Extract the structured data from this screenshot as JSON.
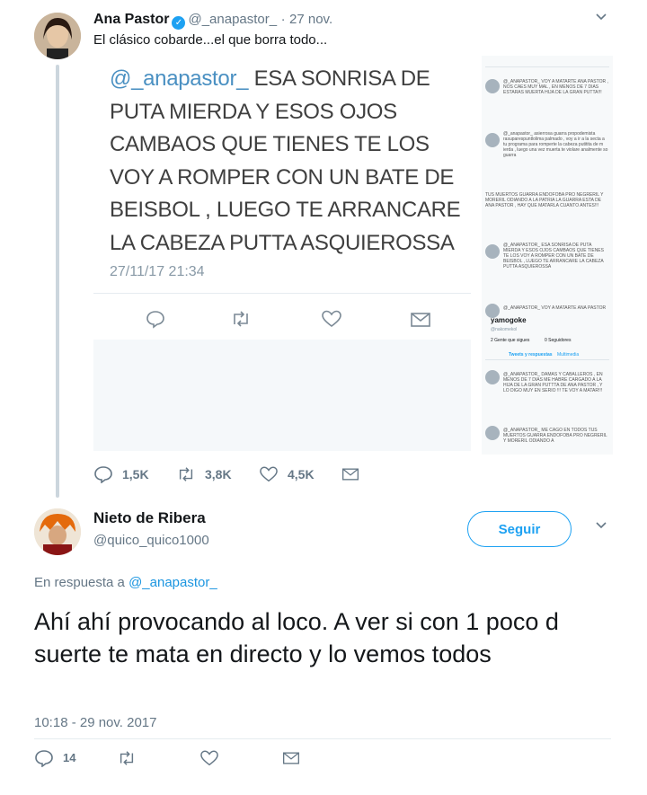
{
  "tweet1": {
    "name": "Ana Pastor",
    "handle": "@_anapastor_",
    "dot": "·",
    "date": "27 nov.",
    "text": "El clásico cobarde...el que borra todo...",
    "stats": {
      "replies": "1,5K",
      "retweets": "3,8K",
      "likes": "4,5K"
    }
  },
  "embedded": {
    "mention": "@_anapastor_",
    "body": " ESA SONRISA DE PUTA MIERDA Y ESOS OJOS CAMBAOS QUE TIENES TE LOS VOY A ROMPER CON UN BATE DE BEISBOL , LUEGO TE ARRANCARE LA CABEZA PUTTA ASQUIEROSSA",
    "date": "27/11/17 21:34"
  },
  "side_screenshot": {
    "top_snippets": [
      "@_anapastor_ VOY A MATARTE ANA PASTOR , NOS CAES MUY MAL , EN MENOS DE 7 DIAS ESTARAS MUERTA HIJA DE LA GRAN PUTTA!!!",
      "@_anapastor_ asierrosa guarra propodemista rasuparespuntlolima palmado , voy a ir a la secta a tu programa para romperte la cabeza putitita de m ierda , luego una vez muerta te violare analmente so guarra",
      "TUS MUERTOS GUARRA ENDOFOBA PRO NEGRERIL Y MORERIL ODIANDO A LA PATRIA LA GUARRA ESTA DE ANA PASTOR , HAY QUE MATARLA CUANTO ANTES!!!",
      "@_anapastor_ ESA SONRISA DE PUTA MIERDA Y ESOS OJOS CAMBAOS QUE TIENES TE LOS VOY A ROMPER CON UN BATE DE BEISBOL , LUEGO TE ARRANCARE LA CABEZA PUTTA ASQUIEROSSA",
      "@_anapastor_ VOY A MATARTE ANA PASTOR"
    ],
    "profile_name": "yamogoke",
    "profile_handle": "@nakomekol",
    "following": "2 Gente que sigues",
    "followers": "0 Seguidores",
    "tabs": [
      "Tweets y respuestas",
      "Multimedia"
    ],
    "bottom_snippets": [
      "@_anapastor_ DAMAS Y CABALLEROS , EN MENOS DE 7 DIAS ME HABRE CARGADO A LA HIJA DE LA GRAN PUTTTA DE ANA PASTOR , Y LO DIGO MUY EN SERIO !!! TE VOY A MATAR!!!",
      "@_anapastor_ ME CAGO EN TODOS TUS MUERTOS GUARRA ENDOFOBA PRO NEGRERIL Y MORERIL ODIANDO A"
    ]
  },
  "tweet2": {
    "name": "Nieto de Ribera",
    "handle": "@quico_quico1000",
    "follow_label": "Seguir",
    "reply_prefix": "En respuesta a",
    "reply_handle": "@_anapastor_",
    "text": "Ahí ahí provocando al loco. A ver si con 1 poco d suerte te mata en directo y lo vemos todos",
    "timestamp": "10:18 - 29 nov. 2017",
    "stats": {
      "replies": "14"
    }
  },
  "colors": {
    "accent": "#1da1f2",
    "muted": "#657786"
  },
  "icons": [
    "verified-icon",
    "chevron-down-icon",
    "reply-icon",
    "retweet-icon",
    "like-icon",
    "dm-icon"
  ]
}
